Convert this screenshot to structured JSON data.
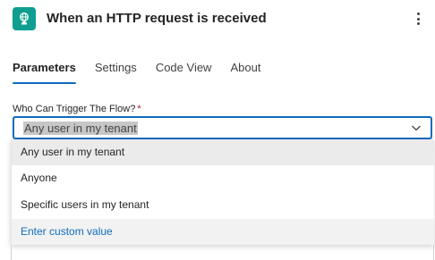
{
  "header": {
    "title": "When an HTTP request is received",
    "icon": "http-request-icon",
    "accent_color": "#0f9e8f",
    "more_icon": "more-vertical-icon"
  },
  "tabs": [
    {
      "label": "Parameters",
      "active": true
    },
    {
      "label": "Settings",
      "active": false
    },
    {
      "label": "Code View",
      "active": false
    },
    {
      "label": "About",
      "active": false
    }
  ],
  "field": {
    "label": "Who Can Trigger The Flow?",
    "required_mark": "*",
    "value": "Any user in my tenant",
    "chevron_icon": "chevron-down-icon",
    "focus_color": "#0f6cbd"
  },
  "dropdown": {
    "options": [
      {
        "label": "Any user in my tenant",
        "selected": true
      },
      {
        "label": "Anyone",
        "selected": false
      },
      {
        "label": "Specific users in my tenant",
        "selected": false
      },
      {
        "label": "Enter custom value",
        "selected": false
      }
    ],
    "link_color": "#0f6cbd"
  }
}
